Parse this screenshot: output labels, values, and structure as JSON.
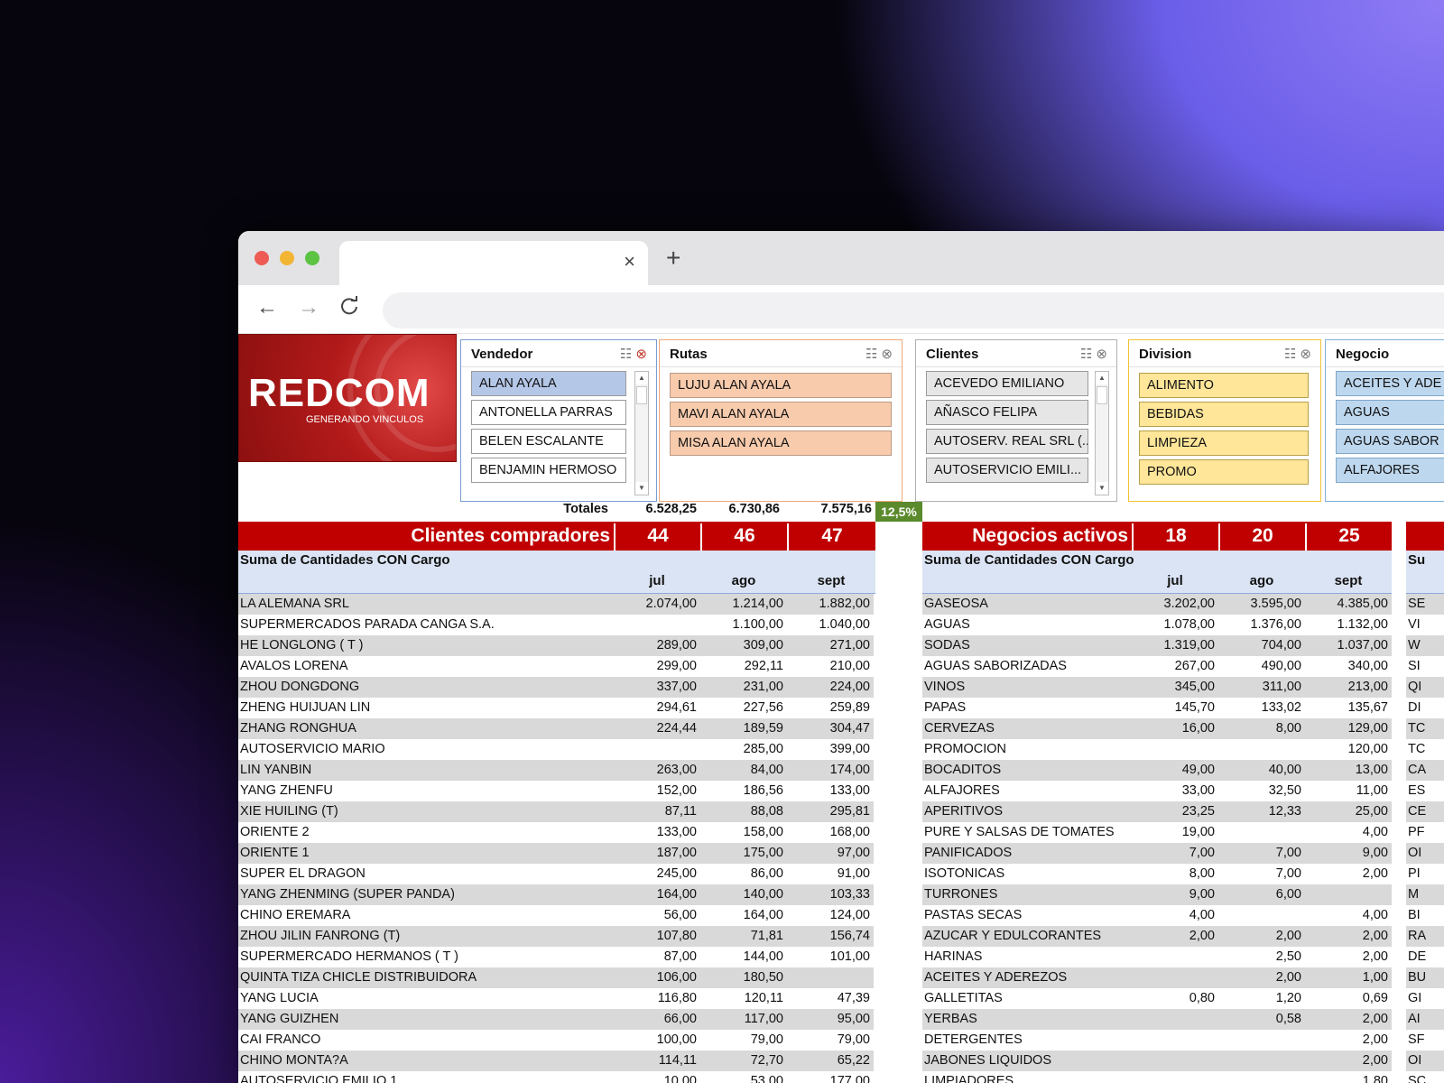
{
  "browser": {
    "tab_close": "×",
    "new_tab": "+",
    "back": "←",
    "forward": "→",
    "reload": "C"
  },
  "logo": {
    "text": "REDCOM",
    "tagline": "GENERANDO VINCULOS"
  },
  "slicers": {
    "vendedor": {
      "title": "Vendedor",
      "items": [
        "ALAN AYALA",
        "ANTONELLA PARRAS",
        "BELEN ESCALANTE",
        "BENJAMIN HERMOSO"
      ],
      "selected": 0
    },
    "rutas": {
      "title": "Rutas",
      "items": [
        "LUJU ALAN AYALA",
        "MAVI ALAN AYALA",
        "MISA ALAN AYALA"
      ]
    },
    "clientes": {
      "title": "Clientes",
      "items": [
        "ACEVEDO EMILIANO",
        "AÑASCO FELIPA",
        "AUTOSERV. REAL SRL (...",
        "AUTOSERVICIO EMILI..."
      ]
    },
    "division": {
      "title": "Division",
      "items": [
        "ALIMENTO",
        "BEBIDAS",
        "LIMPIEZA",
        "PROMO"
      ]
    },
    "negocio": {
      "title": "Negocio",
      "items": [
        "ACEITES Y ADE",
        "AGUAS",
        "AGUAS SABOR",
        "ALFAJORES"
      ]
    }
  },
  "totales": {
    "label": "Totales",
    "values": [
      "6.528,25",
      "6.730,86",
      "7.575,16"
    ],
    "pct": "12,5%"
  },
  "clientes_pivot": {
    "header": "Clientes compradores",
    "counts": [
      "44",
      "46",
      "47"
    ],
    "suma_label": "Suma de Cantidades CON Cargo",
    "months": [
      "jul",
      "ago",
      "sept"
    ],
    "rows": [
      [
        "LA ALEMANA SRL",
        "2.074,00",
        "1.214,00",
        "1.882,00"
      ],
      [
        "SUPERMERCADOS PARADA CANGA S.A.",
        "",
        "1.100,00",
        "1.040,00"
      ],
      [
        "HE LONGLONG ( T )",
        "289,00",
        "309,00",
        "271,00"
      ],
      [
        "AVALOS LORENA",
        "299,00",
        "292,11",
        "210,00"
      ],
      [
        "ZHOU DONGDONG",
        "337,00",
        "231,00",
        "224,00"
      ],
      [
        "ZHENG HUIJUAN LIN",
        "294,61",
        "227,56",
        "259,89"
      ],
      [
        "ZHANG RONGHUA",
        "224,44",
        "189,59",
        "304,47"
      ],
      [
        "AUTOSERVICIO MARIO",
        "",
        "285,00",
        "399,00"
      ],
      [
        "LIN YANBIN",
        "263,00",
        "84,00",
        "174,00"
      ],
      [
        "YANG ZHENFU",
        "152,00",
        "186,56",
        "133,00"
      ],
      [
        "XIE HUILING (T)",
        "87,11",
        "88,08",
        "295,81"
      ],
      [
        "ORIENTE 2",
        "133,00",
        "158,00",
        "168,00"
      ],
      [
        "ORIENTE 1",
        "187,00",
        "175,00",
        "97,00"
      ],
      [
        "SUPER EL DRAGON",
        "245,00",
        "86,00",
        "91,00"
      ],
      [
        "YANG ZHENMING (SUPER PANDA)",
        "164,00",
        "140,00",
        "103,33"
      ],
      [
        "CHINO EREMARA",
        "56,00",
        "164,00",
        "124,00"
      ],
      [
        "ZHOU JILIN FANRONG (T)",
        "107,80",
        "71,81",
        "156,74"
      ],
      [
        "SUPERMERCADO HERMANOS ( T )",
        "87,00",
        "144,00",
        "101,00"
      ],
      [
        "QUINTA TIZA CHICLE DISTRIBUIDORA",
        "106,00",
        "180,50",
        ""
      ],
      [
        "YANG LUCIA",
        "116,80",
        "120,11",
        "47,39"
      ],
      [
        "YANG GUIZHEN",
        "66,00",
        "117,00",
        "95,00"
      ],
      [
        "CAI FRANCO",
        "100,00",
        "79,00",
        "79,00"
      ],
      [
        "CHINO MONTA?A",
        "114,11",
        "72,70",
        "65,22"
      ],
      [
        "AUTOSERVICIO EMILIO 1",
        "10,00",
        "53,00",
        "177,00"
      ]
    ]
  },
  "negocios_pivot": {
    "header": "Negocios activos",
    "counts": [
      "18",
      "20",
      "25"
    ],
    "suma_label": "Suma de Cantidades CON Cargo",
    "months": [
      "jul",
      "ago",
      "sept"
    ],
    "rows": [
      [
        "GASEOSA",
        "3.202,00",
        "3.595,00",
        "4.385,00"
      ],
      [
        "AGUAS",
        "1.078,00",
        "1.376,00",
        "1.132,00"
      ],
      [
        "SODAS",
        "1.319,00",
        "704,00",
        "1.037,00"
      ],
      [
        "AGUAS SABORIZADAS",
        "267,00",
        "490,00",
        "340,00"
      ],
      [
        "VINOS",
        "345,00",
        "311,00",
        "213,00"
      ],
      [
        "PAPAS",
        "145,70",
        "133,02",
        "135,67"
      ],
      [
        "CERVEZAS",
        "16,00",
        "8,00",
        "129,00"
      ],
      [
        "PROMOCION",
        "",
        "",
        "120,00"
      ],
      [
        "BOCADITOS",
        "49,00",
        "40,00",
        "13,00"
      ],
      [
        "ALFAJORES",
        "33,00",
        "32,50",
        "11,00"
      ],
      [
        "APERITIVOS",
        "23,25",
        "12,33",
        "25,00"
      ],
      [
        "PURE Y SALSAS DE TOMATES",
        "19,00",
        "",
        "4,00"
      ],
      [
        "PANIFICADOS",
        "7,00",
        "7,00",
        "9,00"
      ],
      [
        "ISOTONICAS",
        "8,00",
        "7,00",
        "2,00"
      ],
      [
        "TURRONES",
        "9,00",
        "6,00",
        ""
      ],
      [
        "PASTAS SECAS",
        "4,00",
        "",
        "4,00"
      ],
      [
        "AZUCAR Y EDULCORANTES",
        "2,00",
        "2,00",
        "2,00"
      ],
      [
        "HARINAS",
        "",
        "2,50",
        "2,00"
      ],
      [
        "ACEITES Y ADEREZOS",
        "",
        "2,00",
        "1,00"
      ],
      [
        "GALLETITAS",
        "0,80",
        "1,20",
        "0,69"
      ],
      [
        "YERBAS",
        "",
        "0,58",
        "2,00"
      ],
      [
        "DETERGENTES",
        "",
        "",
        "2,00"
      ],
      [
        "JABONES LIQUIDOS",
        "",
        "",
        "2,00"
      ],
      [
        "LIMPIADORES",
        "",
        "",
        "1,80"
      ]
    ]
  },
  "third_pivot": {
    "suma_prefix": "Su",
    "row_prefixes": [
      "SE",
      "VI",
      "W",
      "SI",
      "QI",
      "DI",
      "TC",
      "TC",
      "CA",
      "ES",
      "CE",
      "PF",
      "OI",
      "PI",
      "M",
      "BI",
      "RA",
      "DE",
      "BU",
      "GI",
      "AI",
      "SF",
      "OI",
      "SC"
    ]
  },
  "colors": {
    "header_red": "#c00000",
    "band_blue": "#dbe4f4",
    "row_gray": "#d9d9d9",
    "pct_green": "#5a8a2c"
  }
}
